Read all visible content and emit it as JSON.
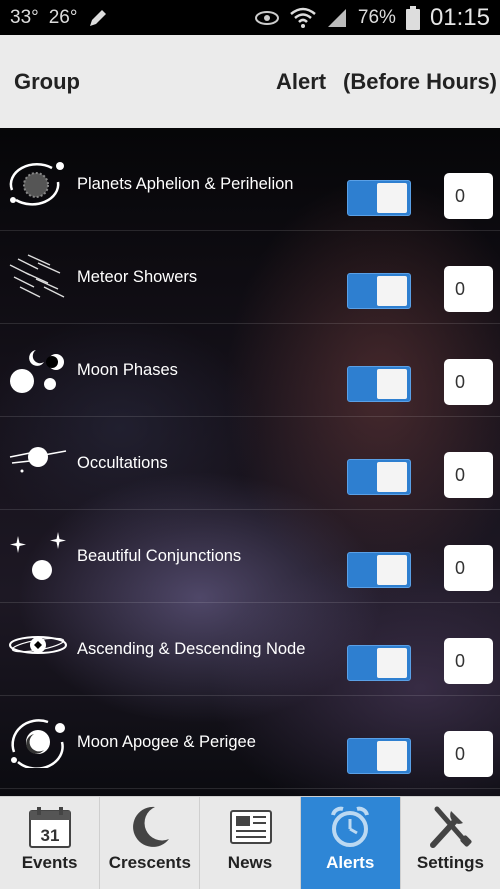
{
  "status_bar": {
    "temp_1": "33°",
    "temp_2": "26°",
    "battery": "76%",
    "time": "01:15"
  },
  "header": {
    "group": "Group",
    "alert": "Alert",
    "before_hours": "(Before Hours)"
  },
  "rows": [
    {
      "label": "Planets Aphelion & Perihelion",
      "icon": "sun-orbit-icon",
      "alert_on": true,
      "hours": "0"
    },
    {
      "label": "Meteor Showers",
      "icon": "meteor-icon",
      "alert_on": true,
      "hours": "0"
    },
    {
      "label": "Moon Phases",
      "icon": "moon-phases-icon",
      "alert_on": true,
      "hours": "0"
    },
    {
      "label": "Occultations",
      "icon": "occultation-icon",
      "alert_on": true,
      "hours": "0"
    },
    {
      "label": "Beautiful Conjunctions",
      "icon": "conjunction-icon",
      "alert_on": true,
      "hours": "0"
    },
    {
      "label": "Ascending & Descending Node",
      "icon": "node-icon",
      "alert_on": true,
      "hours": "0"
    },
    {
      "label": "Moon Apogee & Perigee",
      "icon": "moon-apogee-icon",
      "alert_on": true,
      "hours": "0"
    }
  ],
  "nav": {
    "events": "Events",
    "calendar_day": "31",
    "crescents": "Crescents",
    "news": "News",
    "alerts": "Alerts",
    "settings": "Settings"
  },
  "colors": {
    "accent": "#2e86d6",
    "toggle_on": "#2e7fd0",
    "header_bg": "#ebebeb"
  }
}
